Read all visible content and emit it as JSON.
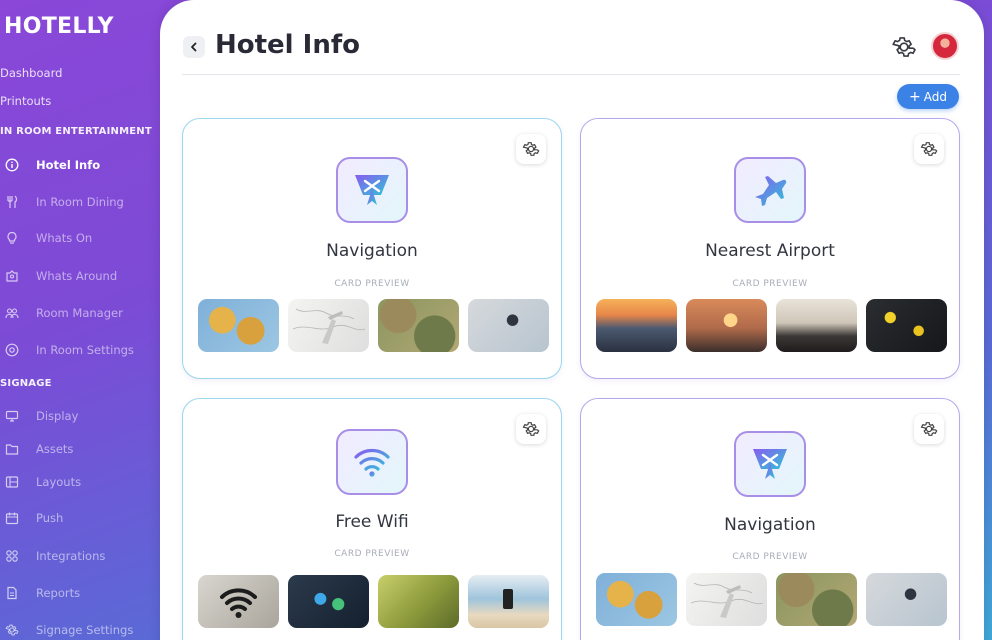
{
  "app": {
    "brand": "HOTELLY"
  },
  "sidebar": {
    "top_links": [
      "Dashboard",
      "Printouts"
    ],
    "sections": [
      {
        "title": "IN ROOM ENTERTAINMENT",
        "items": [
          {
            "label": "Hotel Info",
            "icon": "info-icon",
            "active": true
          },
          {
            "label": "In Room Dining",
            "icon": "cutlery-icon",
            "active": false
          },
          {
            "label": "Whats On",
            "icon": "lightbulb-icon",
            "active": false
          },
          {
            "label": "Whats Around",
            "icon": "location-icon",
            "active": false
          },
          {
            "label": "Room Manager",
            "icon": "users-icon",
            "active": false
          },
          {
            "label": "In Room Settings",
            "icon": "settings-circle-icon",
            "active": false
          }
        ]
      },
      {
        "title": "SIGNAGE",
        "items": [
          {
            "label": "Display",
            "icon": "monitor-icon",
            "active": false
          },
          {
            "label": "Assets",
            "icon": "folder-icon",
            "active": false
          },
          {
            "label": "Layouts",
            "icon": "layout-icon",
            "active": false
          },
          {
            "label": "Push",
            "icon": "calendar-icon",
            "active": false
          },
          {
            "label": "Integrations",
            "icon": "grid-icon",
            "active": false
          },
          {
            "label": "Reports",
            "icon": "document-icon",
            "active": false
          },
          {
            "label": "Signage Settings",
            "icon": "gear-icon",
            "active": false
          }
        ]
      }
    ]
  },
  "header": {
    "title": "Hotel Info",
    "add_label": "Add"
  },
  "cards": [
    {
      "title": "Navigation",
      "icon": "navigation-icon",
      "preview_label": "CARD PREVIEW",
      "thumbnails": [
        "map-with-pins",
        "plane-on-sketch-map",
        "terrain-map",
        "compass-on-map"
      ]
    },
    {
      "title": "Nearest Airport",
      "icon": "airplane-icon",
      "preview_label": "CARD PREVIEW",
      "thumbnails": [
        "airport-runway-sunset",
        "plane-at-dusk",
        "terminal-window",
        "departure-board"
      ]
    },
    {
      "title": "Free Wifi",
      "icon": "wifi-icon",
      "preview_label": "CARD PREVIEW",
      "thumbnails": [
        "wifi-sign",
        "phone-app-icons",
        "free-wifi-sign",
        "phone-at-beach"
      ]
    },
    {
      "title": "Navigation",
      "icon": "navigation-icon",
      "preview_label": "CARD PREVIEW",
      "thumbnails": [
        "map-with-pins",
        "plane-on-sketch-map",
        "terrain-map",
        "compass-on-map"
      ]
    }
  ],
  "colors": {
    "accent": "#3b82e6",
    "brand_gradient_start": "#8a47d8",
    "brand_gradient_end": "#3fa8d8",
    "icon_border": "#a88ee6"
  }
}
